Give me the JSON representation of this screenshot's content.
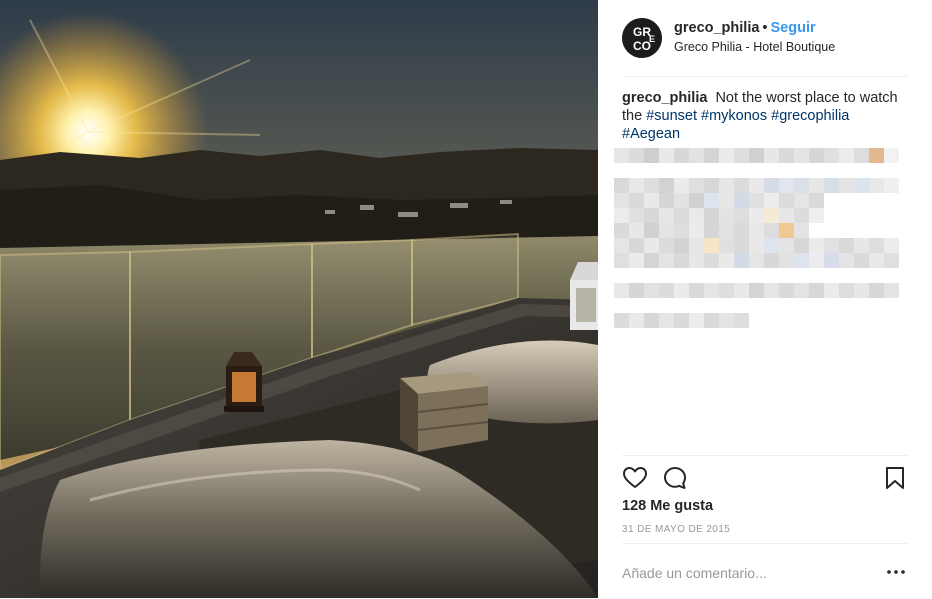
{
  "post": {
    "username": "greco_philia",
    "separator": "•",
    "follow_label": "Seguir",
    "location": "Greco Philia - Hotel Boutique",
    "avatar_text": "GRECO",
    "caption": {
      "username": "greco_philia",
      "text": "Not the worst place to watch the",
      "hashtags": [
        "#sunset",
        "#mykonos",
        "#grecophilia",
        "#Aegean"
      ]
    },
    "likes_label": "128 Me gusta",
    "date_label": "31 DE MAYO DE 2015",
    "comment_placeholder": "Añade un comentario..."
  },
  "icons": {
    "like": "heart-icon",
    "comment": "comment-bubble-icon",
    "save": "bookmark-icon",
    "more": "more-options-icon"
  },
  "colors": {
    "follow": "#3897f0",
    "hashtag": "#003569",
    "muted": "#999999",
    "divider": "#efefef"
  }
}
